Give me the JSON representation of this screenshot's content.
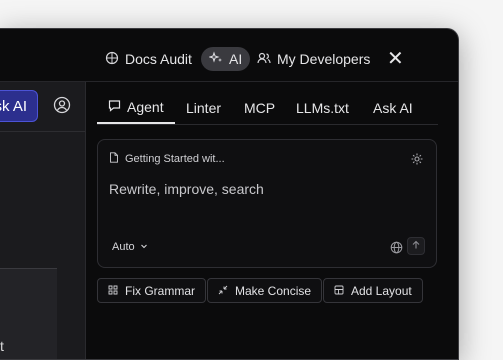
{
  "topbar": {
    "docs_audit": "Docs Audit",
    "ai": "AI",
    "my_developers": "My Developers",
    "close": "✕"
  },
  "left": {
    "ask_ai": "sk AI",
    "fragment": "t"
  },
  "tabs": [
    {
      "label": "Agent",
      "active": true
    },
    {
      "label": "Linter"
    },
    {
      "label": "MCP"
    },
    {
      "label": "LLMs.txt"
    },
    {
      "label": "Ask AI"
    }
  ],
  "card": {
    "doc_chip": "Getting Started wit...",
    "prompt_placeholder": "Rewrite, improve, search",
    "mode": "Auto"
  },
  "actions": {
    "fix_grammar": "Fix Grammar",
    "make_concise": "Make Concise",
    "add_layout": "Add Layout"
  },
  "colors": {
    "accent": "#2c2f8e",
    "background": "#0b0b0c"
  }
}
